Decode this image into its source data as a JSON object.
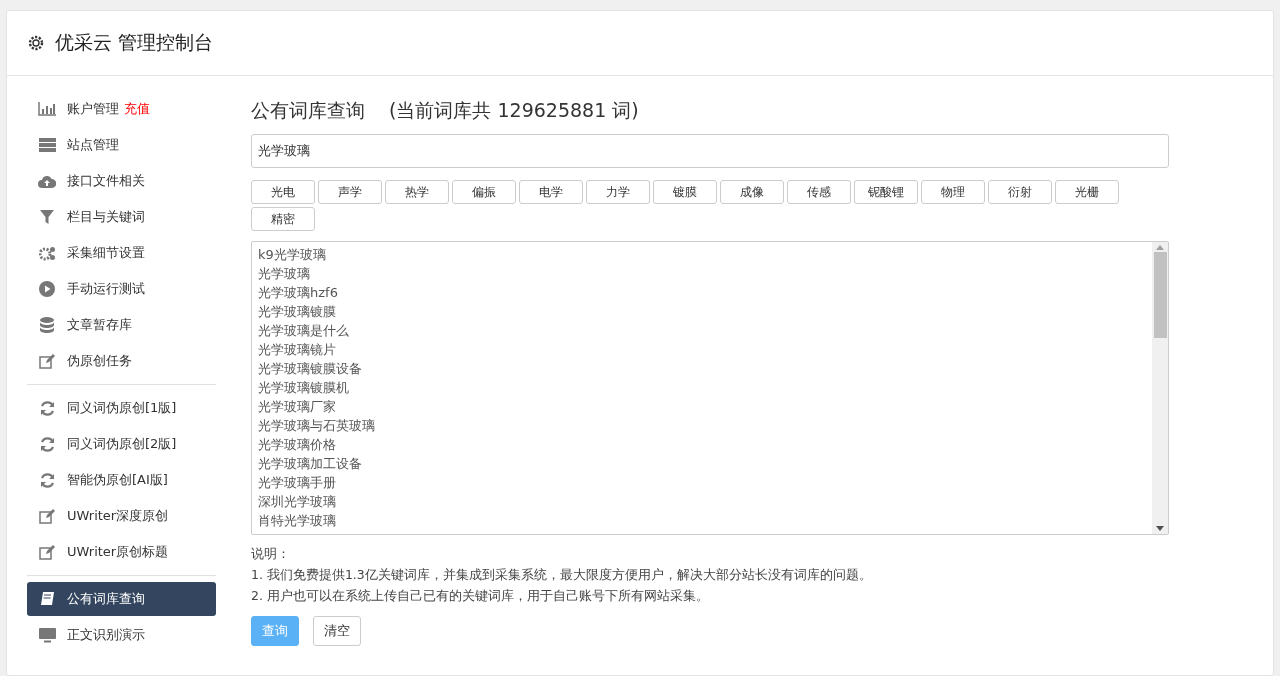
{
  "header": {
    "title": "优采云 管理控制台"
  },
  "sidebar": {
    "groups": [
      {
        "items": [
          {
            "label": "账户管理",
            "badge": "充值",
            "selected": false
          },
          {
            "label": "站点管理",
            "selected": false
          },
          {
            "label": "接口文件相关",
            "selected": false
          },
          {
            "label": "栏目与关键词",
            "selected": false
          },
          {
            "label": "采集细节设置",
            "selected": false
          },
          {
            "label": "手动运行测试",
            "selected": false
          },
          {
            "label": "文章暂存库",
            "selected": false
          },
          {
            "label": "伪原创任务",
            "selected": false
          }
        ]
      },
      {
        "items": [
          {
            "label": "同义词伪原创[1版]",
            "selected": false
          },
          {
            "label": "同义词伪原创[2版]",
            "selected": false
          },
          {
            "label": "智能伪原创[AI版]",
            "selected": false
          },
          {
            "label": "UWriter深度原创",
            "selected": false
          },
          {
            "label": "UWriter原创标题",
            "selected": false
          }
        ]
      },
      {
        "items": [
          {
            "label": "公有词库查询",
            "selected": true
          },
          {
            "label": "正文识别演示",
            "selected": false
          }
        ]
      }
    ]
  },
  "main": {
    "title": "公有词库查询",
    "count_note": "(当前词库共 129625881 词)",
    "search": {
      "value": "光学玻璃"
    },
    "tags": [
      "光电",
      "声学",
      "热学",
      "偏振",
      "电学",
      "力学",
      "镀膜",
      "成像",
      "传感",
      "铌酸锂",
      "物理",
      "衍射",
      "光栅",
      "精密"
    ],
    "results": [
      "k9光学玻璃",
      "光学玻璃",
      "光学玻璃hzf6",
      "光学玻璃镀膜",
      "光学玻璃是什么",
      "光学玻璃镜片",
      "光学玻璃镀膜设备",
      "光学玻璃镀膜机",
      "光学玻璃厂家",
      "光学玻璃与石英玻璃",
      "光学玻璃价格",
      "光学玻璃加工设备",
      "光学玻璃手册",
      "深圳光学玻璃",
      "肖特光学玻璃"
    ],
    "notes_title": "说明：",
    "notes": [
      "1. 我们免费提供1.3亿关键词库，并集成到采集系统，最大限度方便用户，解决大部分站长没有词库的问题。",
      "2. 用户也可以在系统上传自己已有的关键词库，用于自己账号下所有网站采集。"
    ],
    "buttons": [
      {
        "label": "查询",
        "kind": "primary"
      },
      {
        "label": "清空",
        "kind": "default"
      }
    ]
  }
}
